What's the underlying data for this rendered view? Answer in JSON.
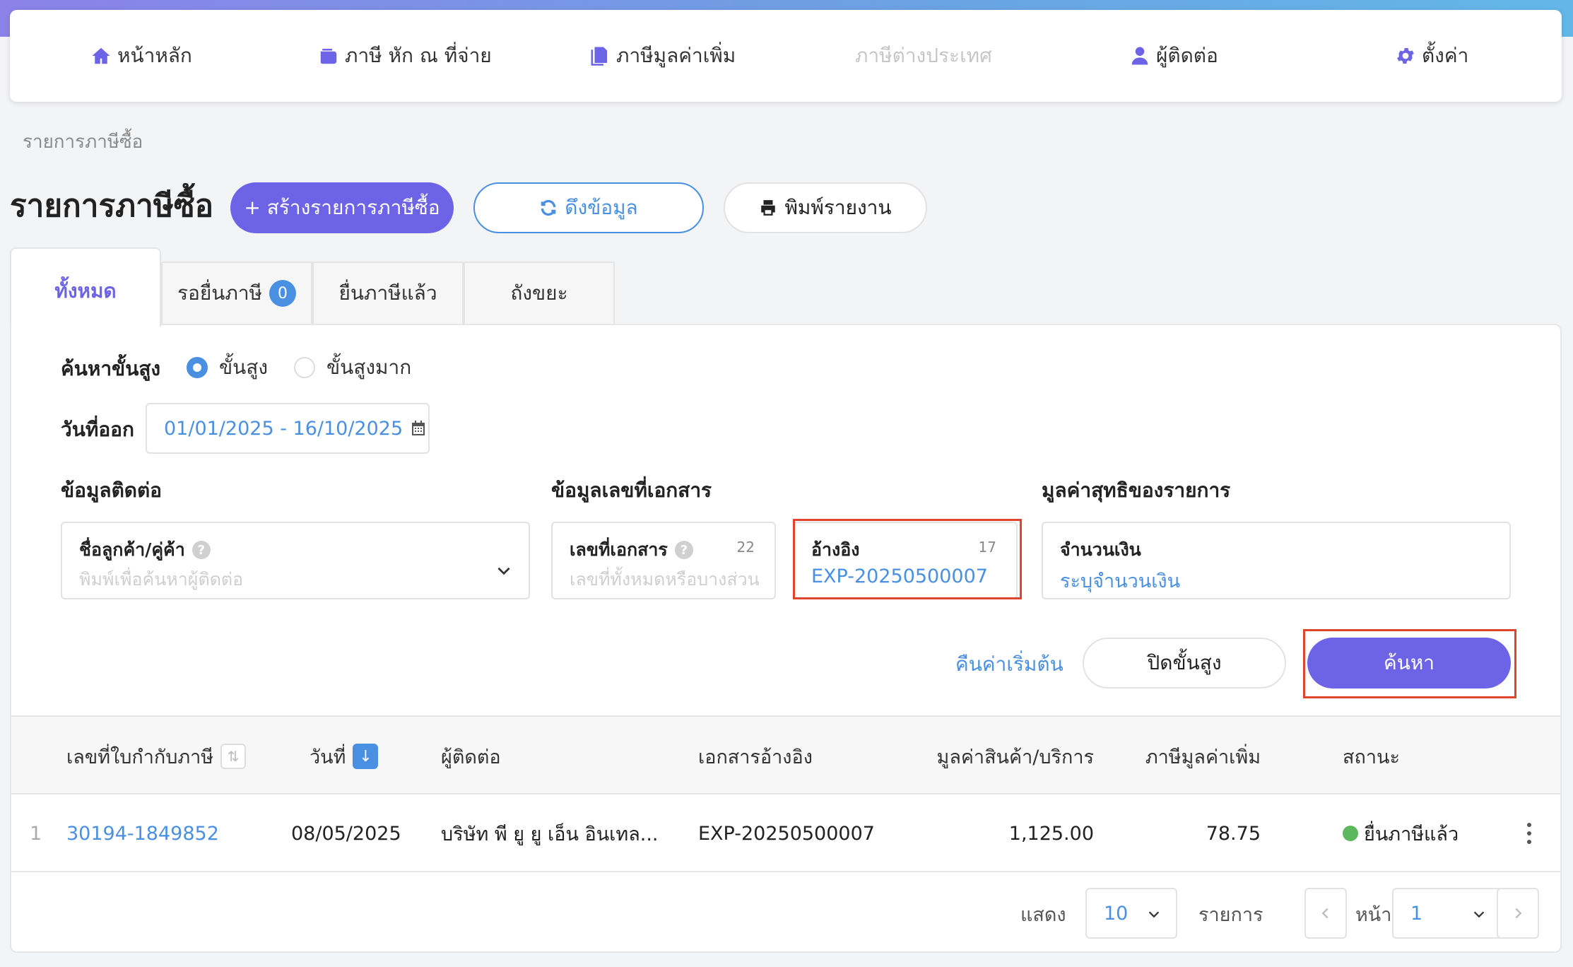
{
  "nav": {
    "home": "หน้าหลัก",
    "wht": "ภาษี หัก ณ ที่จ่าย",
    "vat": "ภาษีมูลค่าเพิ่ม",
    "foreign": "ภาษีต่างประเทศ",
    "contacts": "ผู้ติดต่อ",
    "settings": "ตั้งค่า"
  },
  "breadcrumb": "รายการภาษีซื้อ",
  "page_title": "รายการภาษีซื้อ",
  "actions": {
    "create": "+ สร้างรายการภาษีซื้อ",
    "fetch": "ดึงข้อมูล",
    "print": "พิมพ์รายงาน"
  },
  "tabs": [
    {
      "label": "ทั้งหมด"
    },
    {
      "label": "รอยื่นภาษี",
      "badge": "0"
    },
    {
      "label": "ยื่นภาษีแล้ว"
    },
    {
      "label": "ถังขยะ"
    }
  ],
  "search": {
    "advanced_label": "ค้นหาขั้นสูง",
    "option_advanced": "ขั้นสูง",
    "option_very_advanced": "ขั้นสูงมาก",
    "date_label": "วันที่ออก",
    "date_range": "01/01/2025 - 16/10/2025",
    "contact_section": "ข้อมูลติดต่อ",
    "doc_section": "ข้อมูลเลขที่เอกสาร",
    "amount_section": "มูลค่าสุทธิของรายการ",
    "customer_label": "ชื่อลูกค้า/คู่ค้า",
    "customer_placeholder": "พิมพ์เพื่อค้นหาผู้ติดต่อ",
    "docno_label": "เลขที่เอกสาร",
    "docno_count": "22",
    "docno_placeholder": "เลขที่ทั้งหมดหรือบางส่วน",
    "ref_label": "อ้างอิง",
    "ref_count": "17",
    "ref_value": "EXP-20250500007",
    "amount_label": "จำนวนเงิน",
    "amount_placeholder": "ระบุจำนวนเงิน",
    "reset": "คืนค่าเริ่มต้น",
    "close_advanced": "ปิดขั้นสูง",
    "submit": "ค้นหา"
  },
  "table": {
    "headers": [
      "เลขที่ใบกำกับภาษี",
      "วันที่",
      "ผู้ติดต่อ",
      "เอกสารอ้างอิง",
      "มูลค่าสินค้า/บริการ",
      "ภาษีมูลค่าเพิ่ม",
      "สถานะ"
    ],
    "rows": [
      {
        "index": "1",
        "invoice_no": "30194-1849852",
        "date": "08/05/2025",
        "contact": "บริษัท พี ยู ยู เอ็น อินเทล...",
        "reference": "EXP-20250500007",
        "amount": "1,125.00",
        "vat": "78.75",
        "status": "ยื่นภาษีแล้ว"
      }
    ]
  },
  "pager": {
    "show": "แสดง",
    "per_page": "10",
    "items": "รายการ",
    "page_label": "หน้า",
    "page": "1"
  },
  "colors": {
    "primary": "#6c63e6",
    "link": "#4a90e2",
    "highlight": "#e0442f",
    "status_ok": "#5cb85c"
  }
}
